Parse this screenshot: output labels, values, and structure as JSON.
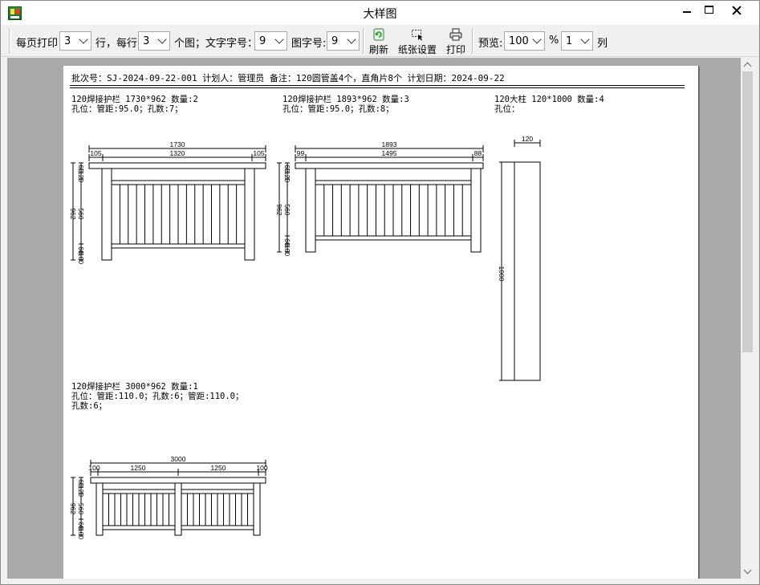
{
  "window": {
    "title": "大样图"
  },
  "toolbar": {
    "rows_per_page_label": "每页打印",
    "rows_per_page_value": "3",
    "row_label": "行，每行",
    "per_row_value": "3",
    "diagrams_label": "个图；文字字号：",
    "text_size_value": "9",
    "figure_size_label": "图字号:",
    "figure_size_value": "9",
    "refresh_label": "刷新",
    "paper_setup_label": "纸张设置",
    "print_label": "打印",
    "preview_label": "预览:",
    "zoom_value": "100",
    "percent_label": "%",
    "columns_value": "1",
    "columns_label": "列"
  },
  "paper": {
    "batch_line": "批次号：SJ-2024-09-22-001 计划人：管理员 备注：120圆管盖4个，直角片8个 计划日期：2024-09-22",
    "items": [
      {
        "title": "120焊接护栏 1730*962  数量:2",
        "holes": [
          "孔位：管距:95.0；孔数:7；"
        ],
        "dims": {
          "total": "1730",
          "left": "105",
          "middle": "1320",
          "right": "105",
          "height": "962",
          "top": "120",
          "top2": "60",
          "mid": "560",
          "bottom1": "60",
          "bottom2": "100"
        }
      },
      {
        "title": "120焊接护栏 1893*962  数量:3",
        "holes": [
          "孔位：管距:95.0；孔数:8；"
        ],
        "dims": {
          "total": "1893",
          "left": "99",
          "middle": "1495",
          "right": "88",
          "height": "962",
          "top": "120",
          "top2": "60",
          "mid": "560",
          "bottom1": "60",
          "bottom2": "100"
        }
      },
      {
        "title": "120大柱 120*1000  数量:4",
        "holes": [
          "孔位："
        ],
        "dims": {
          "width": "120",
          "height": "1000"
        }
      },
      {
        "title": "120焊接护栏 3000*962  数量:1",
        "holes": [
          "孔位：管距:110.0；孔数:6；管距:110.0；",
          "孔数:6；"
        ],
        "dims": {
          "total": "3000",
          "left": "100",
          "seg1": "1250",
          "seg2": "1250",
          "right": "100",
          "height": "962",
          "top": "120",
          "top2": "60",
          "mid": "560",
          "bottom1": "60",
          "bottom2": "100"
        }
      }
    ]
  }
}
